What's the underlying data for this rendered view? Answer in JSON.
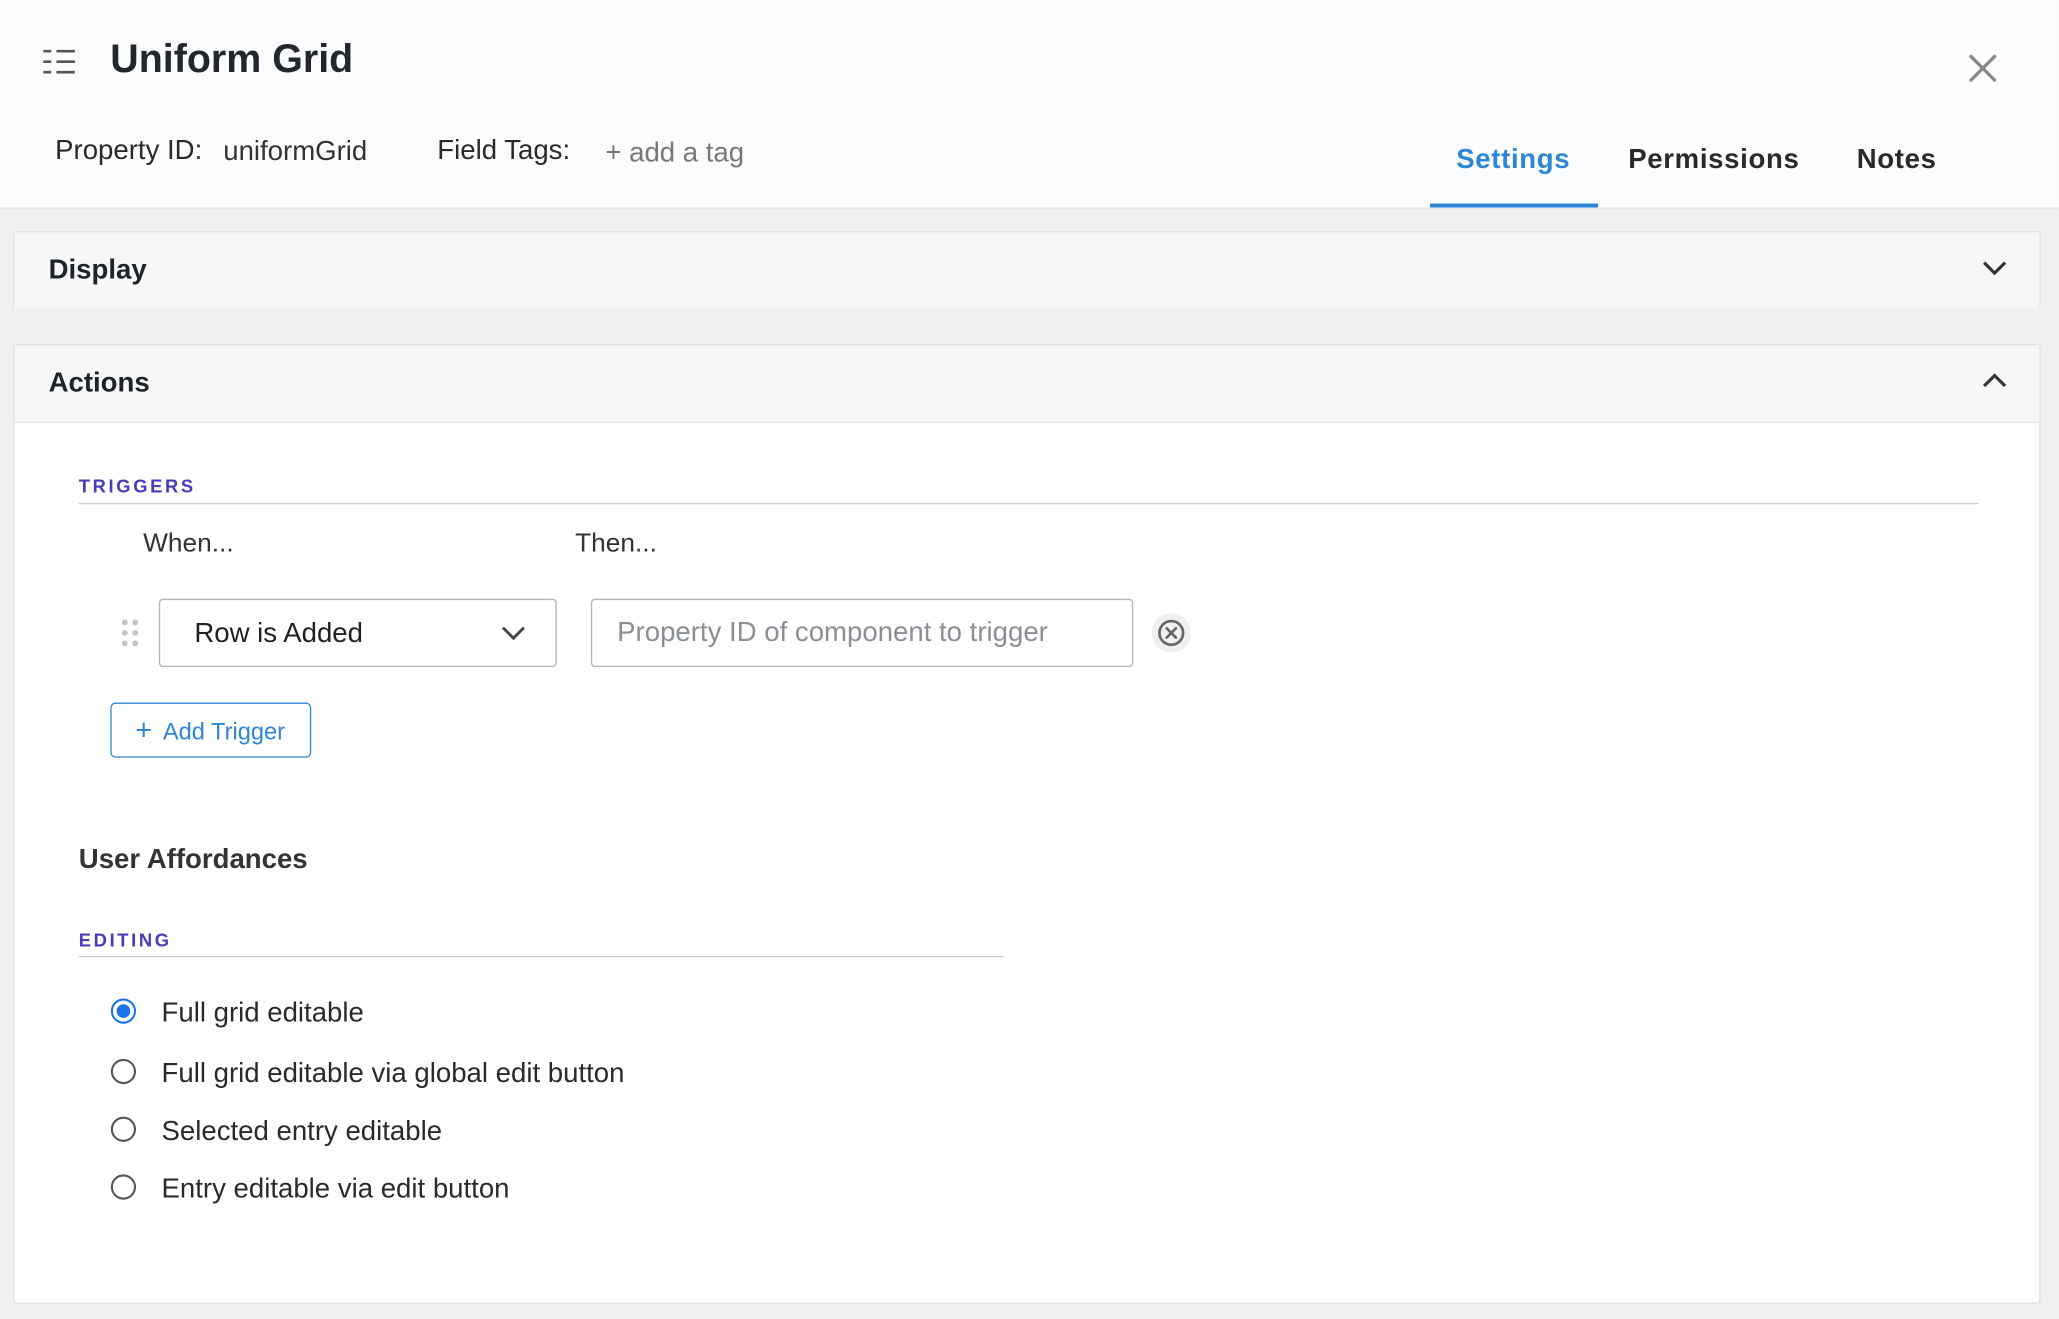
{
  "header": {
    "title": "Uniform Grid",
    "property_id_label": "Property ID:",
    "property_id_value": "uniformGrid",
    "field_tags_label": "Field Tags:",
    "add_tag": "+ add a tag",
    "tabs": [
      {
        "label": "Settings",
        "active": true
      },
      {
        "label": "Permissions",
        "active": false
      },
      {
        "label": "Notes",
        "active": false
      }
    ]
  },
  "display_panel": {
    "title": "Display",
    "expanded": false
  },
  "actions_panel": {
    "title": "Actions",
    "expanded": true,
    "triggers": {
      "section_label": "TRIGGERS",
      "when_label": "When...",
      "then_label": "Then...",
      "rows": [
        {
          "event": "Row is Added",
          "target_value": "",
          "target_placeholder": "Property ID of component to trigger"
        }
      ],
      "add_button": "Add Trigger"
    },
    "user_affordances": {
      "title": "User Affordances",
      "section_label": "EDITING",
      "options": [
        {
          "label": "Full grid editable",
          "selected": true
        },
        {
          "label": "Full grid editable via global edit button",
          "selected": false
        },
        {
          "label": "Selected entry editable",
          "selected": false
        },
        {
          "label": "Entry editable via edit button",
          "selected": false
        }
      ]
    }
  },
  "colors": {
    "accent": "#2e86d6",
    "section_label": "#4a3cb8"
  },
  "icons": [
    "list-icon",
    "close-icon",
    "chevron-down-icon",
    "chevron-up-icon",
    "drag-handle-icon",
    "remove-circle-icon",
    "plus-icon"
  ]
}
